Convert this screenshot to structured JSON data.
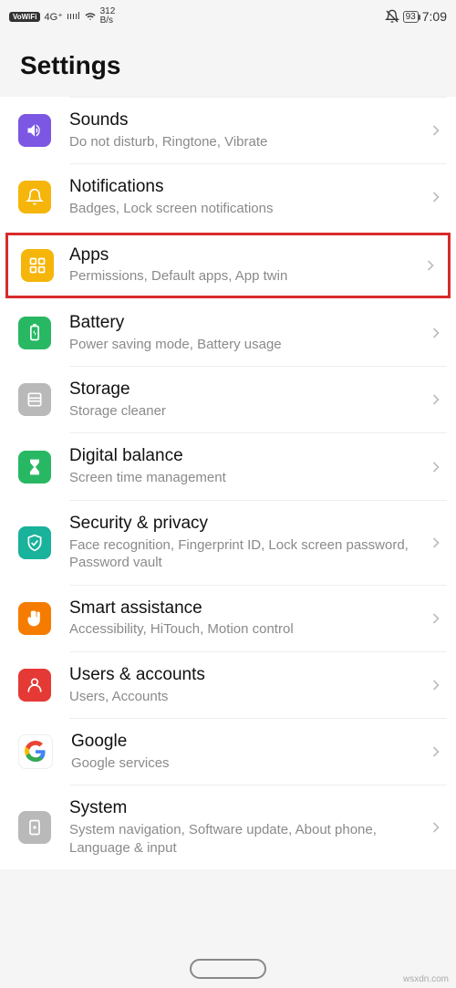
{
  "status": {
    "vowifi": "VoWiFi",
    "net": "4G⁺",
    "signal": "ııııl",
    "wifi": "􀙇",
    "speed_top": "312",
    "speed_bot": "B/s",
    "dnd": "🔕",
    "battery": "93",
    "time": "7:09"
  },
  "header": {
    "title": "Settings"
  },
  "rows": {
    "sounds": {
      "title": "Sounds",
      "sub": "Do not disturb, Ringtone, Vibrate"
    },
    "notifications": {
      "title": "Notifications",
      "sub": "Badges, Lock screen notifications"
    },
    "apps": {
      "title": "Apps",
      "sub": "Permissions, Default apps, App twin"
    },
    "battery": {
      "title": "Battery",
      "sub": "Power saving mode, Battery usage"
    },
    "storage": {
      "title": "Storage",
      "sub": "Storage cleaner"
    },
    "digital": {
      "title": "Digital balance",
      "sub": "Screen time management"
    },
    "security": {
      "title": "Security & privacy",
      "sub": "Face recognition, Fingerprint ID, Lock screen password, Password vault"
    },
    "smart": {
      "title": "Smart assistance",
      "sub": "Accessibility, HiTouch, Motion control"
    },
    "users": {
      "title": "Users & accounts",
      "sub": "Users, Accounts"
    },
    "google": {
      "title": "Google",
      "sub": "Google services"
    },
    "system": {
      "title": "System",
      "sub": "System navigation, Software update, About phone, Language & input"
    }
  },
  "watermark": "wsxdn.com"
}
